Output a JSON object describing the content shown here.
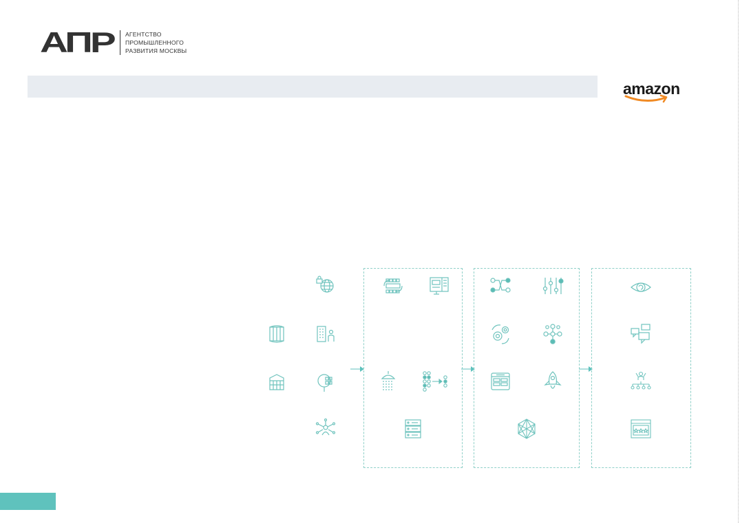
{
  "brand": {
    "logo_mark": "АПР",
    "agency_lines": [
      "АГЕНТСТВО",
      "ПРОМЫШЛЕННОГО",
      "РАЗВИТИЯ МОСКВЫ"
    ]
  },
  "partner": {
    "name": "amazon"
  },
  "colors": {
    "accent": "#5fc2bd",
    "icon_stroke": "#6fc3bd",
    "icon_fill": "#5bbcb5",
    "box_border": "#8fd0c8",
    "title_bar": "#e8ecf1",
    "logo_dark": "#333333"
  },
  "diagram": {
    "sources": [
      {
        "icon": "globe-lock-icon"
      },
      {
        "icon": "database-cylinder-icon"
      },
      {
        "icon": "office-building-user-icon"
      },
      {
        "icon": "database-grid-icon"
      },
      {
        "icon": "magnifier-qr-icon"
      },
      {
        "icon": "user-network-icon"
      }
    ],
    "stage_ingest": [
      {
        "icon": "cpu-chip-sync-icon"
      },
      {
        "icon": "monitor-dashboard-icon"
      },
      {
        "icon": "shower-stream-icon"
      },
      {
        "icon": "dot-matrix-transform-icon"
      },
      {
        "icon": "server-rack-icon"
      }
    ],
    "stage_process": [
      {
        "icon": "node-connection-icon"
      },
      {
        "icon": "slider-controls-icon"
      },
      {
        "icon": "gears-cycle-icon"
      },
      {
        "icon": "node-cluster-icon"
      },
      {
        "icon": "table-window-icon"
      },
      {
        "icon": "rocket-launch-icon"
      },
      {
        "icon": "hexagon-network-icon"
      }
    ],
    "stage_output": [
      {
        "icon": "eye-icon"
      },
      {
        "icon": "chat-bubbles-icon"
      },
      {
        "icon": "team-hierarchy-icon"
      },
      {
        "icon": "rating-window-icon"
      }
    ]
  }
}
